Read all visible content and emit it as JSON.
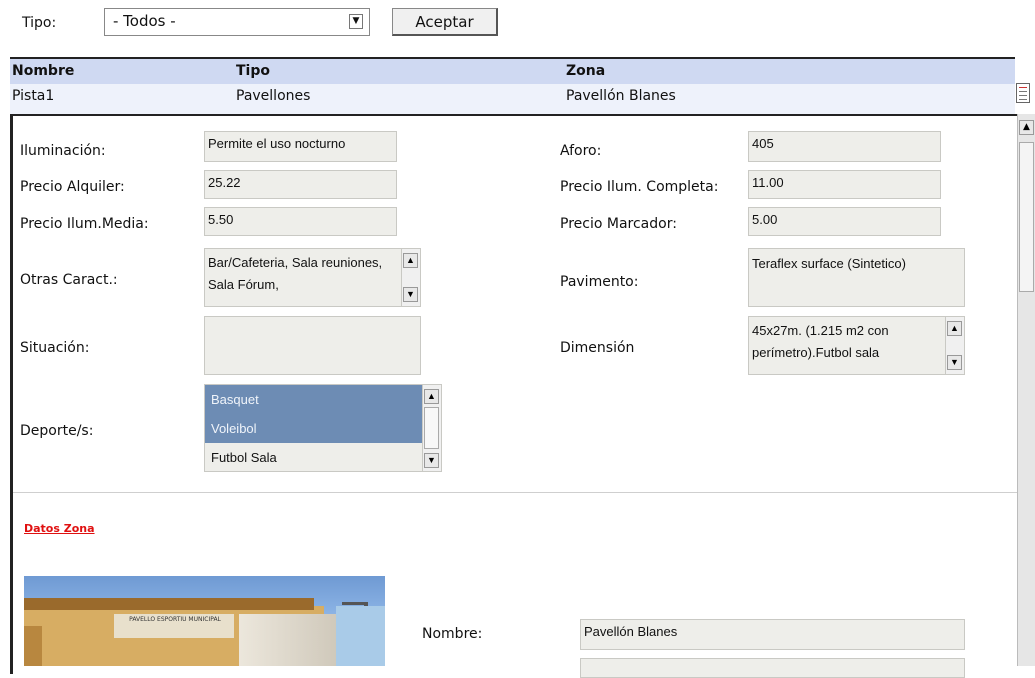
{
  "filter": {
    "label": "Tipo:",
    "selected": "- Todos -",
    "button": "Aceptar"
  },
  "grid": {
    "headers": [
      "Nombre",
      "Tipo",
      "Zona"
    ],
    "row": {
      "nombre": "Pista1",
      "tipo": "Pavellones",
      "zona": "Pavellón Blanes"
    }
  },
  "details": {
    "iluminacion": {
      "label": "Iluminación:",
      "value": "Permite el uso nocturno"
    },
    "aforo": {
      "label": "Aforo:",
      "value": "405"
    },
    "precio_alquiler": {
      "label": "Precio Alquiler:",
      "value": "25.22"
    },
    "precio_ilum_completa": {
      "label": "Precio Ilum. Completa:",
      "value": "11.00"
    },
    "precio_ilum_media": {
      "label": "Precio Ilum.Media:",
      "value": "5.50"
    },
    "precio_marcador": {
      "label": "Precio Marcador:",
      "value": "5.00"
    },
    "otras_caract": {
      "label": "Otras Caract.:",
      "value": "Bar/Cafeteria, Sala reuniones, Sala Fórum,"
    },
    "pavimento": {
      "label": "Pavimento:",
      "value": "Teraflex surface (Sintetico)"
    },
    "situacion": {
      "label": "Situación:",
      "value": ""
    },
    "dimension": {
      "label": "Dimensión",
      "value": "45x27m. (1.215 m2 con perímetro).Futbol sala"
    },
    "deportes": {
      "label": "Deporte/s:",
      "options": [
        "Basquet",
        "Voleibol",
        "Futbol Sala"
      ],
      "selected": [
        "Basquet",
        "Voleibol"
      ]
    }
  },
  "zona": {
    "title": "Datos Zona",
    "photo_text": "PAVELLO ESPORTIU MUNICIPAL",
    "nombre": {
      "label": "Nombre:",
      "value": "Pavellón Blanes"
    }
  },
  "icons": {
    "row_action": "document-icon",
    "scroll_up": "arrow-up-icon",
    "scroll_down": "arrow-down-icon",
    "select_arrow": "chevron-down-icon"
  },
  "colors": {
    "header_bg": "#cfd9f2",
    "row_bg": "#eef2fb",
    "field_bg": "#eeeeea",
    "selected_option": "#6d8cb4",
    "zone_title": "#e01010"
  }
}
